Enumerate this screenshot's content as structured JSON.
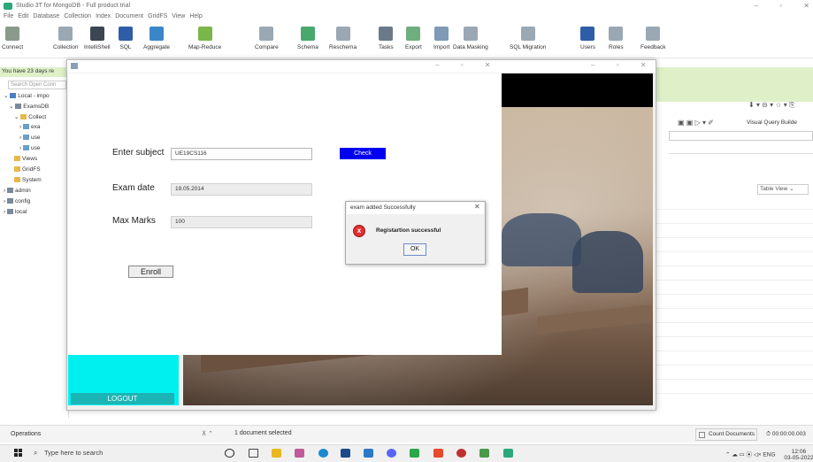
{
  "app": {
    "title": "Studio 3T for MongoDB - Full product trial",
    "menu": [
      "File",
      "Edit",
      "Database",
      "Collection",
      "Index",
      "Document",
      "GridFS",
      "View",
      "Help"
    ],
    "toolbar": [
      {
        "label": "Connect",
        "icon": "connect-icon",
        "color": "#8a9a8a"
      },
      {
        "label": "Collection",
        "icon": "collection-icon",
        "color": "#9aa8b4"
      },
      {
        "label": "IntelliShell",
        "icon": "shell-icon",
        "color": "#3b4652"
      },
      {
        "label": "SQL",
        "icon": "sql-icon",
        "color": "#2f5ea8"
      },
      {
        "label": "Aggregate",
        "icon": "aggregate-icon",
        "color": "#3a86c8"
      },
      {
        "label": "Map-Reduce",
        "icon": "map-reduce-icon",
        "color": "#7ab648"
      },
      {
        "label": "Compare",
        "icon": "compare-icon",
        "color": "#9aa8b4"
      },
      {
        "label": "Schema",
        "icon": "schema-icon",
        "color": "#4aa86c"
      },
      {
        "label": "Reschema",
        "icon": "reschema-icon",
        "color": "#9aa8b4"
      },
      {
        "label": "Tasks",
        "icon": "tasks-icon",
        "color": "#6a7a8a"
      },
      {
        "label": "Export",
        "icon": "export-icon",
        "color": "#6fae7e"
      },
      {
        "label": "Import",
        "icon": "import-icon",
        "color": "#7e9ab4"
      },
      {
        "label": "Data Masking",
        "icon": "data-masking-icon",
        "color": "#9aa8b4"
      },
      {
        "label": "SQL Migration",
        "icon": "sql-migration-icon",
        "color": "#9aa8b4"
      },
      {
        "label": "Users",
        "icon": "users-icon",
        "color": "#2f5ea8"
      },
      {
        "label": "Roles",
        "icon": "roles-icon",
        "color": "#9aa8b4"
      },
      {
        "label": "Feedback",
        "icon": "feedback-icon",
        "color": "#9aa8b4"
      }
    ],
    "trial_message": "You have 23 days re",
    "search_placeholder": "Search Open Conn",
    "tree": [
      {
        "label": "Local - impo",
        "indent": 0,
        "color": "#4a7fc8"
      },
      {
        "label": "ExamsDB",
        "indent": 1,
        "color": "#7a8a9a"
      },
      {
        "label": "Collect",
        "indent": 2,
        "color": "#e8b84a"
      },
      {
        "label": "exa",
        "indent": 3,
        "color": "#6aa0c8"
      },
      {
        "label": "use",
        "indent": 3,
        "color": "#6aa0c8"
      },
      {
        "label": "use",
        "indent": 3,
        "color": "#6aa0c8"
      },
      {
        "label": "Views",
        "indent": 2,
        "color": "#e8b84a"
      },
      {
        "label": "GridFS",
        "indent": 2,
        "color": "#e8b84a"
      },
      {
        "label": "System",
        "indent": 2,
        "color": "#e8b84a"
      },
      {
        "label": "admin",
        "indent": 0,
        "color": "#7a8a9a"
      },
      {
        "label": "config",
        "indent": 0,
        "color": "#7a8a9a"
      },
      {
        "label": "local",
        "indent": 0,
        "color": "#7a8a9a"
      }
    ],
    "right": {
      "visual_query_builder": "Visual Query Builde",
      "table_view": "Table View"
    },
    "status": {
      "operations": "Operations",
      "selected": "1 document selected",
      "count_documents": "Count Documents",
      "timer": "00:00:00.003"
    }
  },
  "java_app": {
    "subject_label": "Enter subject",
    "subject_value": "UE19CS116",
    "check_label": "Check",
    "exam_date_label": "Exam date",
    "exam_date_value": "19.05.2014",
    "max_marks_label": "Max Marks",
    "max_marks_value": "100",
    "enroll_label": "Enroll",
    "logout_label": "LOGOUT",
    "accent_color": "#0000f0",
    "side_color": "#00f0f0"
  },
  "dialog": {
    "title": "exam added Successfully",
    "message": "Registartion successful",
    "ok_label": "OK",
    "icon": "error-icon"
  },
  "taskbar": {
    "search_placeholder": "Type here to search",
    "apps": [
      {
        "icon": "cortana-icon",
        "color": "#222"
      },
      {
        "icon": "task-view-icon",
        "color": "#444"
      },
      {
        "icon": "file-explorer-icon",
        "color": "#e8b820"
      },
      {
        "icon": "slack-icon",
        "color": "#c05a9a"
      },
      {
        "icon": "edge-icon",
        "color": "#1a8ad0"
      },
      {
        "icon": "mail-icon",
        "color": "#1a4a8a"
      },
      {
        "icon": "settings-icon",
        "color": "#2a7ac8"
      },
      {
        "icon": "discord-icon",
        "color": "#5865f2"
      },
      {
        "icon": "chrome-icon",
        "color": "#2aa84a"
      },
      {
        "icon": "brave-icon",
        "color": "#e84a2a"
      },
      {
        "icon": "cherry-icon",
        "color": "#c03030"
      },
      {
        "icon": "photos-icon",
        "color": "#4a9a4a"
      },
      {
        "icon": "studio3t-icon",
        "color": "#2aa87a"
      }
    ],
    "lang": "ENG",
    "time": "12:06",
    "date": "03-05-2022"
  }
}
